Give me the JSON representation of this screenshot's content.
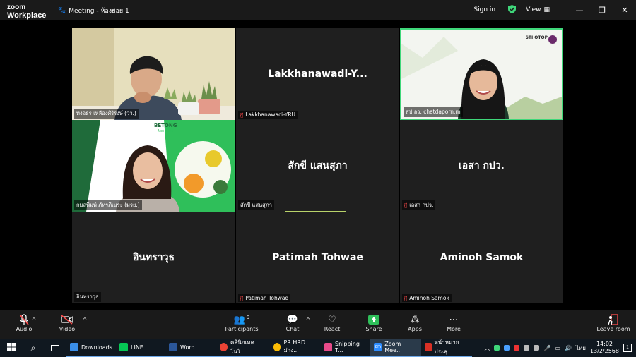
{
  "app": {
    "logo_line1": "zoom",
    "logo_line2": "Workplace",
    "meeting_title": "Meeting - ห้องย่อย 1",
    "sign_in": "Sign in",
    "view": "View"
  },
  "participants": [
    {
      "display_name": "",
      "tag": "ทงอธร เหลืองศิริรงษ์ (วว.)",
      "muted": false,
      "video": true
    },
    {
      "display_name": "Lakkhanawadi-Y...",
      "tag": "Lakkhanawadi-YRU",
      "muted": true,
      "video": false
    },
    {
      "display_name": "",
      "tag": "สป.อว. chatdaporn.m",
      "muted": true,
      "video": true,
      "active_speaker": true
    },
    {
      "display_name": "",
      "tag": "กมลพิมพ์ ภัทรภิเษระ (มรย.)",
      "muted": false,
      "video": true,
      "banner_text": "BETONG",
      "banner_sub": "Net Zero"
    },
    {
      "display_name": "สักขี แสนสุภา",
      "tag": "สักขี แสนสุภา",
      "muted": false,
      "video": false
    },
    {
      "display_name": "เอสา กปว.",
      "tag": "เอสา กปว.",
      "muted": true,
      "video": false
    },
    {
      "display_name": "อินทราวุธ",
      "tag": "อินทราวุธ",
      "muted": false,
      "video": false
    },
    {
      "display_name": "Patimah Tohwae",
      "tag": "Patimah Tohwae",
      "muted": true,
      "video": false
    },
    {
      "display_name": "Aminoh Samok",
      "tag": "Aminoh Samok",
      "muted": true,
      "video": false
    }
  ],
  "toolbar": {
    "audio": "Audio",
    "video": "Video",
    "participants": "Participants",
    "participants_count": "9",
    "chat": "Chat",
    "react": "React",
    "share": "Share",
    "apps": "Apps",
    "more": "More",
    "leave": "Leave room"
  },
  "taskbar": {
    "items": [
      "Downloads",
      "LINE",
      "Word",
      "คลินิกเทคโนโ...",
      "PR HRD ม่าง...",
      "Snipping T...",
      "Zoom Mee...",
      "หน้าหมายประสุ..."
    ],
    "lang": "ไทย",
    "time": "14:02",
    "date": "13/2/2568",
    "notif_count": "1"
  },
  "sti_logo": "STI OTOP"
}
